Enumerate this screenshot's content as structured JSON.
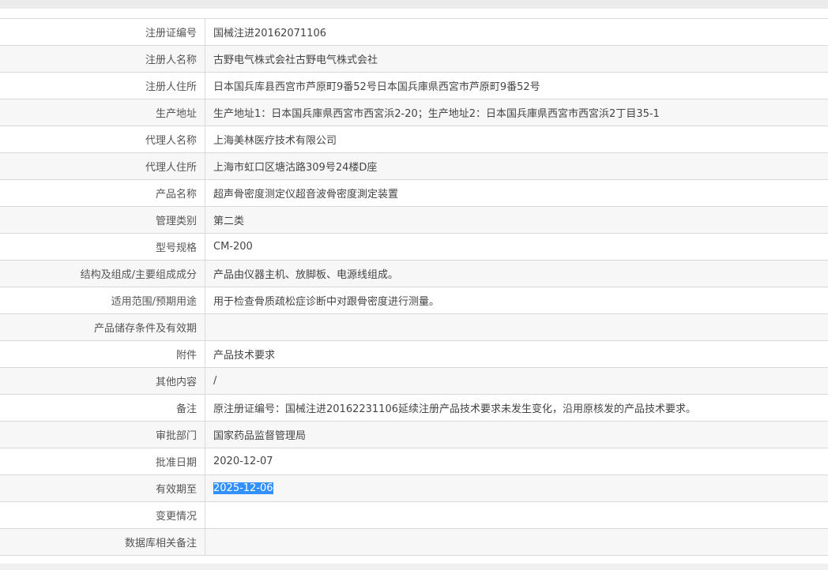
{
  "rows": [
    {
      "label": "注册证编号",
      "value": "国械注进20162071106"
    },
    {
      "label": "注册人名称",
      "value": "古野电气株式会社古野电气株式会社"
    },
    {
      "label": "注册人住所",
      "value": "日本国兵库县西宫市芦原町9番52号日本国兵庫県西宮市芦原町9番52号"
    },
    {
      "label": "生产地址",
      "value": "生产地址1：日本国兵庫県西宮市西宮浜2-20；生产地址2：日本国兵庫県西宮市西宮浜2丁目35-1"
    },
    {
      "label": "代理人名称",
      "value": "上海美林医疗技术有限公司"
    },
    {
      "label": "代理人住所",
      "value": "上海市虹口区塘沽路309号24楼D座"
    },
    {
      "label": "产品名称",
      "value": "超声骨密度测定仪超音波骨密度測定装置"
    },
    {
      "label": "管理类别",
      "value": "第二类"
    },
    {
      "label": "型号规格",
      "value": "CM-200"
    },
    {
      "label": "结构及组成/主要组成成分",
      "value": "产品由仪器主机、放脚板、电源线组成。"
    },
    {
      "label": "适用范围/预期用途",
      "value": "用于检查骨质疏松症诊断中对跟骨密度进行测量。"
    },
    {
      "label": "产品储存条件及有效期",
      "value": ""
    },
    {
      "label": "附件",
      "value": "产品技术要求"
    },
    {
      "label": "其他内容",
      "value": "/"
    },
    {
      "label": "备注",
      "value": "原注册证编号：国械注进20162231106延续注册产品技术要求未发生变化，沿用原核发的产品技术要求。"
    },
    {
      "label": "审批部门",
      "value": "国家药品监督管理局"
    },
    {
      "label": "批准日期",
      "value": "2020-12-07"
    },
    {
      "label": "有效期至",
      "value": "2025-12-06"
    },
    {
      "label": "变更情况",
      "value": ""
    },
    {
      "label": "数据库相关备注",
      "value": ""
    }
  ],
  "selected_row_index": 17,
  "colors": {
    "selection": "#3390ff",
    "row_alt": "#f7f7f7",
    "border": "#d9d9d9"
  }
}
